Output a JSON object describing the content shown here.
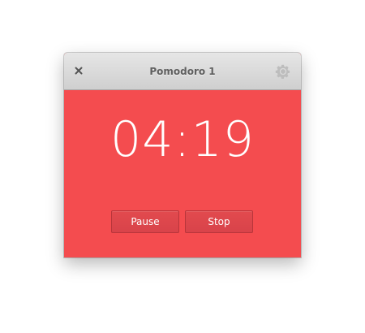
{
  "window": {
    "title": "Pomodoro 1"
  },
  "timer": {
    "display": "04:19"
  },
  "controls": {
    "pause_label": "Pause",
    "stop_label": "Stop"
  },
  "icons": {
    "close": "close-icon",
    "settings": "gear-icon"
  },
  "colors": {
    "background": "#f44c4f",
    "button": "#dc464c",
    "titlebar": "#d9d9d9",
    "text": "#ffffff"
  }
}
